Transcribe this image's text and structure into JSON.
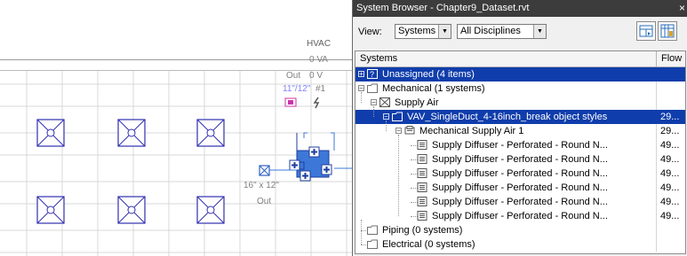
{
  "canvas": {
    "panel_label": "HVAC",
    "va_label": "0 VA",
    "out_label": "Out",
    "volt_label": "0 V",
    "dim_label": "11\"/12\"",
    "circuit_label": "#1",
    "duct_size": "16\" x 12\"",
    "out_label_lower": "Out"
  },
  "browser": {
    "title": "System Browser - Chapter9_Dataset.rvt",
    "close_glyph": "×",
    "view_label": "View:",
    "view_select": "Systems",
    "discipline_select": "All Disciplines",
    "columns": {
      "systems": "Systems",
      "flow": "Flow"
    },
    "rows": [
      {
        "label": "Unassigned (4 items)",
        "flow": "",
        "level": 0,
        "exp": "+",
        "icon": "unassigned-icon",
        "selected": true
      },
      {
        "label": "Mechanical (1 systems)",
        "flow": "",
        "level": 0,
        "exp": "−",
        "icon": "folder-icon",
        "selected": false
      },
      {
        "label": "Supply Air",
        "flow": "",
        "level": 1,
        "exp": "−",
        "icon": "supply-air-icon",
        "selected": false
      },
      {
        "label": "VAV_SingleDuct_4-16inch_break object styles",
        "flow": "29...",
        "level": 2,
        "exp": "−",
        "icon": "folder-icon",
        "selected": true
      },
      {
        "label": "Mechanical Supply Air 1",
        "flow": "29...",
        "level": 3,
        "exp": "−",
        "icon": "system-icon",
        "selected": false
      },
      {
        "label": "Supply Diffuser - Perforated - Round N...",
        "flow": "49...",
        "level": 4,
        "exp": "",
        "icon": "diffuser-icon",
        "selected": false
      },
      {
        "label": "Supply Diffuser - Perforated - Round N...",
        "flow": "49...",
        "level": 4,
        "exp": "",
        "icon": "diffuser-icon",
        "selected": false
      },
      {
        "label": "Supply Diffuser - Perforated - Round N...",
        "flow": "49...",
        "level": 4,
        "exp": "",
        "icon": "diffuser-icon",
        "selected": false
      },
      {
        "label": "Supply Diffuser - Perforated - Round N...",
        "flow": "49...",
        "level": 4,
        "exp": "",
        "icon": "diffuser-icon",
        "selected": false
      },
      {
        "label": "Supply Diffuser - Perforated - Round N...",
        "flow": "49...",
        "level": 4,
        "exp": "",
        "icon": "diffuser-icon",
        "selected": false
      },
      {
        "label": "Supply Diffuser - Perforated - Round N...",
        "flow": "49...",
        "level": 4,
        "exp": "",
        "icon": "diffuser-icon",
        "selected": false
      },
      {
        "label": "Piping (0 systems)",
        "flow": "",
        "level": 0,
        "exp": "",
        "icon": "folder-icon",
        "selected": false
      },
      {
        "label": "Electrical (0 systems)",
        "flow": "",
        "level": 0,
        "exp": "",
        "icon": "folder-icon",
        "selected": false
      }
    ]
  },
  "colors": {
    "selection": "#0f3dab",
    "titlebar": "#3c3c3c",
    "canvas_line": "#3030b0",
    "grid_line": "#d8d8d8"
  }
}
